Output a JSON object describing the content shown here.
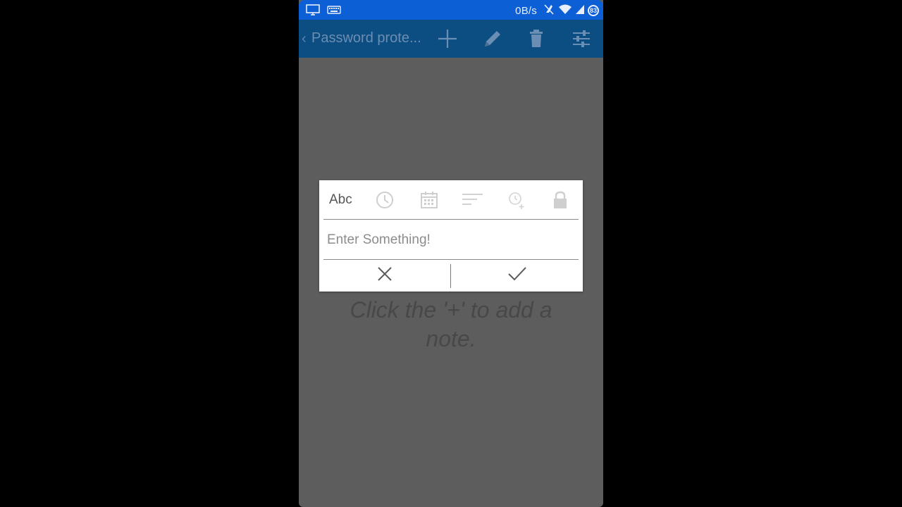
{
  "status_bar": {
    "network_speed": "0B/s",
    "battery_level": "83",
    "icons": [
      "monitor-icon",
      "keyboard-icon",
      "mute-icon",
      "wifi-icon",
      "signal-icon",
      "battery-icon"
    ],
    "background_color": "#0d5fd6"
  },
  "action_bar": {
    "title": "Password prote...",
    "actions": [
      "add-icon",
      "edit-icon",
      "delete-icon",
      "settings-icon"
    ],
    "background_color": "#0c4d82"
  },
  "dialog": {
    "toolbar": {
      "abc_label": "Abc",
      "tools": [
        "clock-icon",
        "calendar-icon",
        "sort-icon",
        "alarm-add-icon",
        "lock-icon"
      ]
    },
    "input": {
      "value": "",
      "placeholder": "Enter Something!"
    },
    "buttons": [
      "close-icon",
      "check-icon"
    ]
  },
  "empty_state": {
    "hint": "Click the '+' to add a note."
  }
}
